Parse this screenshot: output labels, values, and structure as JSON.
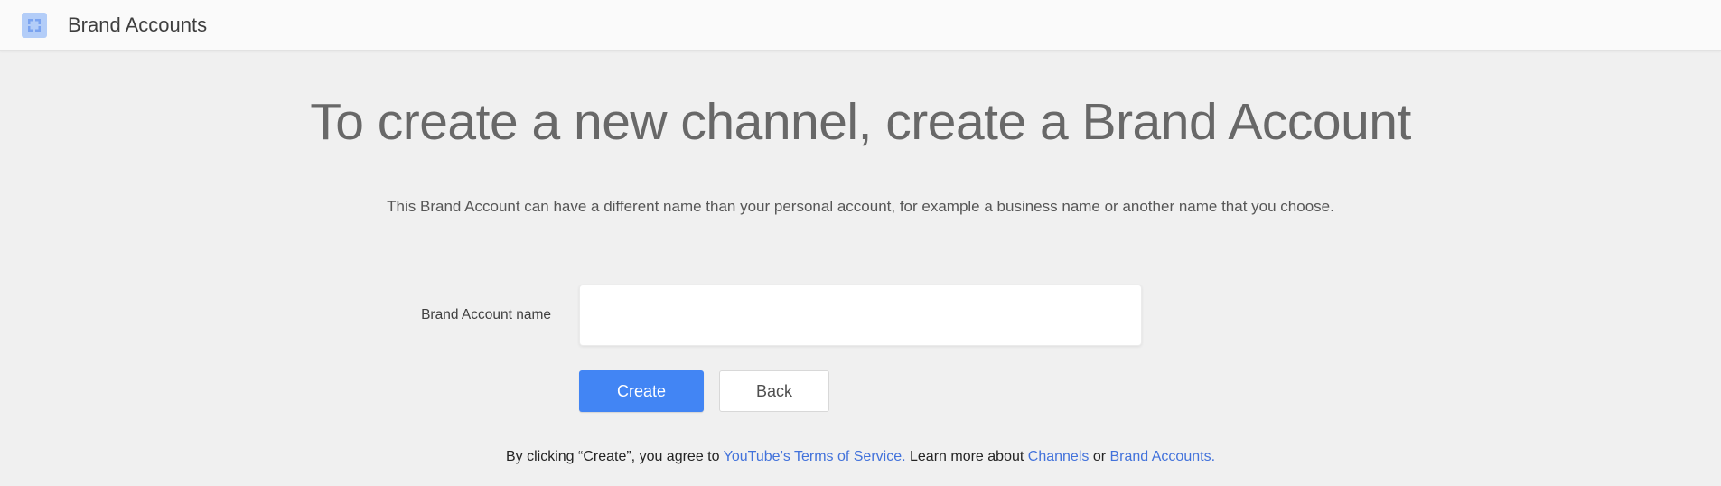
{
  "header": {
    "title": "Brand Accounts",
    "icon": "brand-accounts-icon"
  },
  "main": {
    "heading": "To create a new channel, create a Brand Account",
    "subtitle": "This Brand Account can have a different name than your personal account, for example a business name or another name that you choose.",
    "form": {
      "label": "Brand Account name",
      "input_value": ""
    },
    "buttons": {
      "create": "Create",
      "back": "Back"
    },
    "footer": {
      "part1": "By clicking “Create”, you agree to ",
      "tos_link": "YouTube’s Terms of Service.",
      "part2": " Learn more about ",
      "channels_link": "Channels",
      "part3": " or ",
      "brand_accounts_link": "Brand Accounts."
    }
  },
  "colors": {
    "accent_blue": "#4285f4",
    "link_blue": "#4272db",
    "page_background": "#f0f0f0",
    "topbar_background": "#fafafa",
    "icon_background": "#b3cdf8",
    "icon_glyph": "#7aa3f0"
  }
}
